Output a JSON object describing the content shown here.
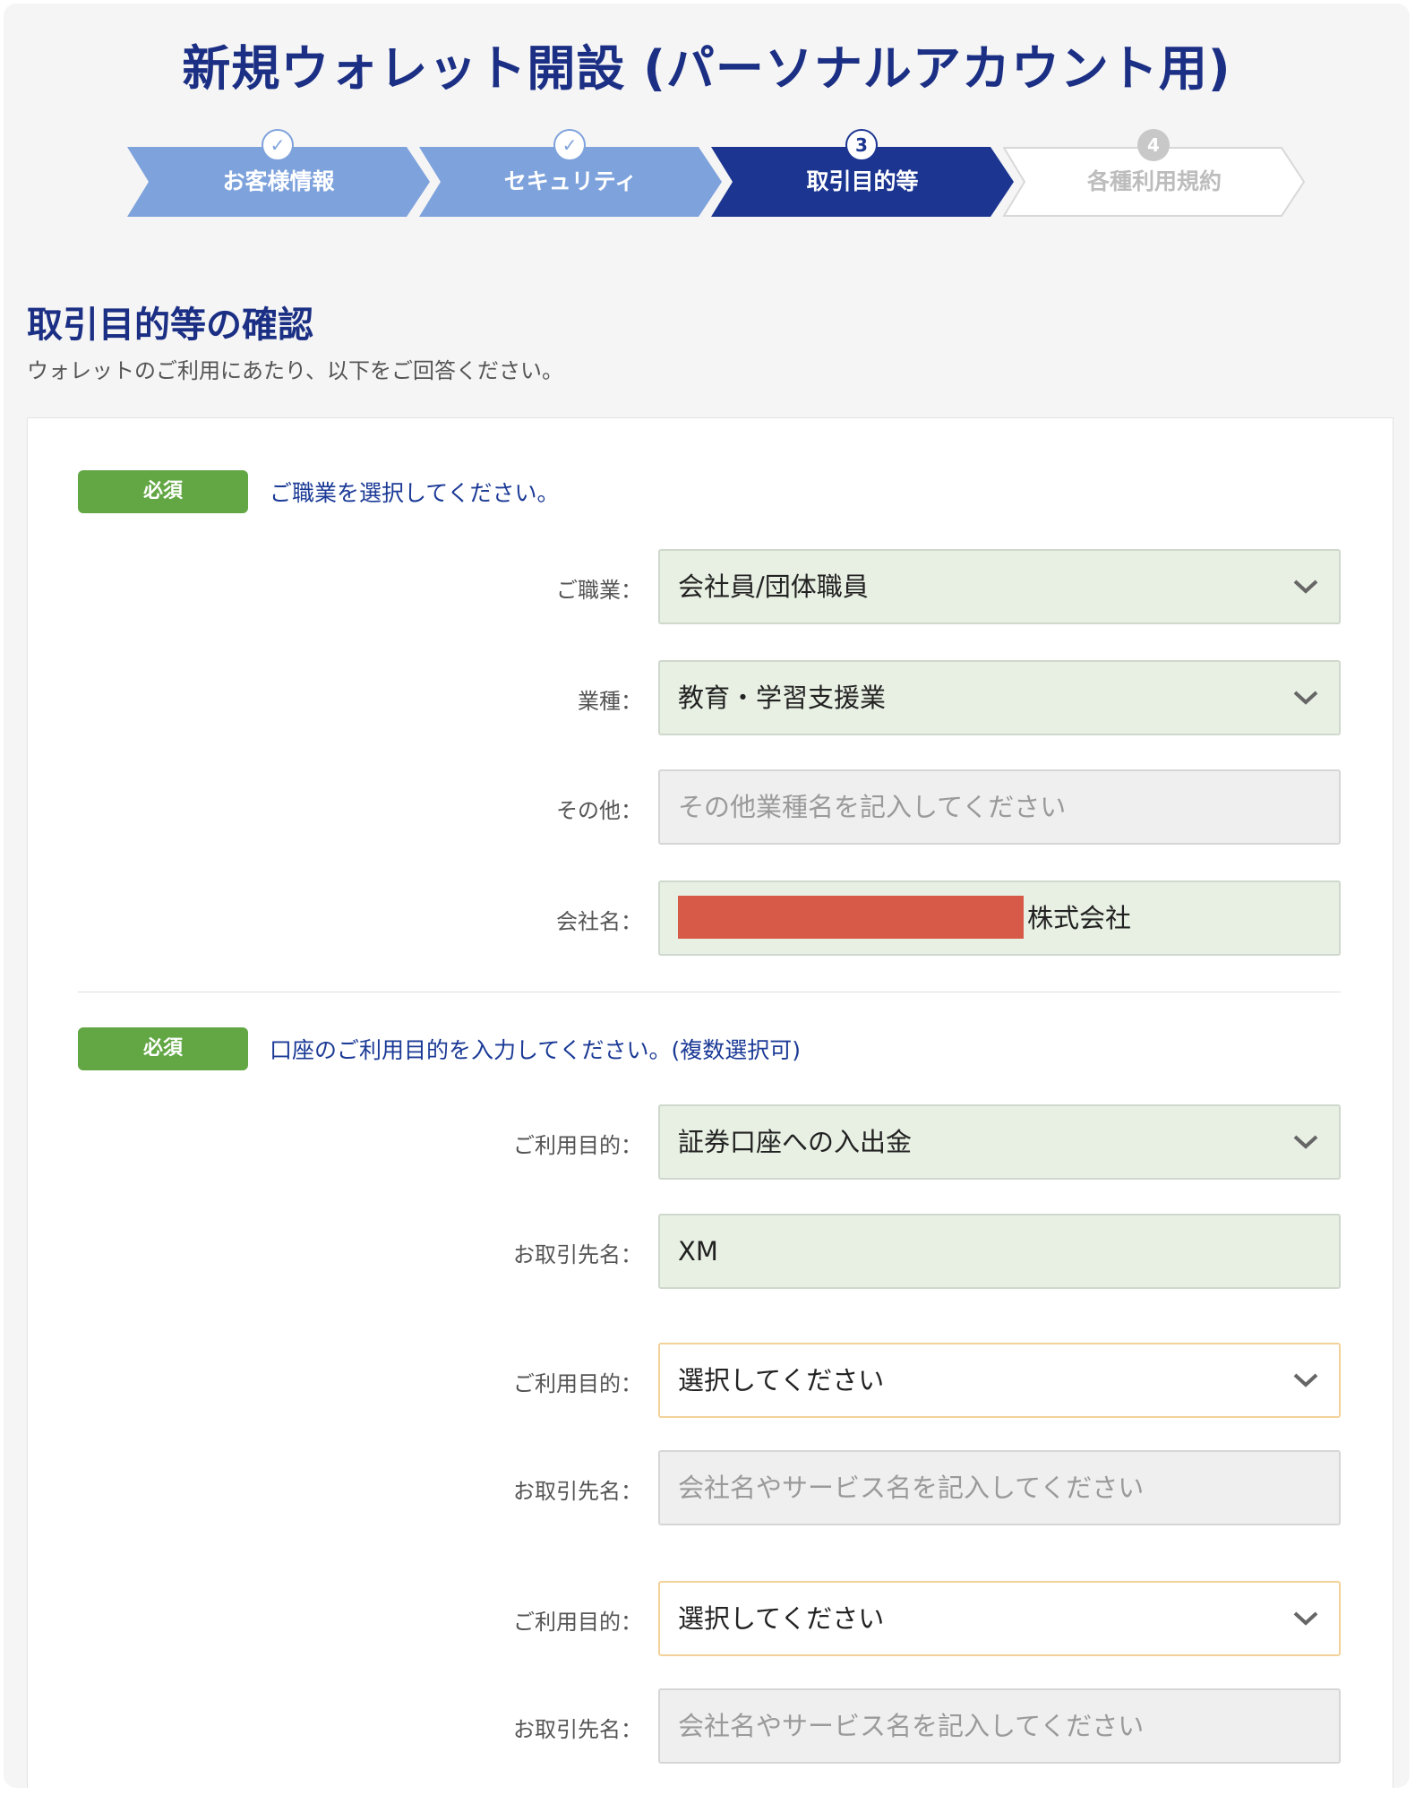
{
  "page_title": "新規ウォレット開設 (パーソナルアカウント用)",
  "steps": [
    {
      "label": "お客様情報",
      "marker": "✓",
      "state": "done"
    },
    {
      "label": "セキュリティ",
      "marker": "✓",
      "state": "done"
    },
    {
      "label": "取引目的等",
      "marker": "3",
      "state": "active"
    },
    {
      "label": "各種利用規約",
      "marker": "4",
      "state": "pending"
    }
  ],
  "section": {
    "title": "取引目的等の確認",
    "description": "ウォレットのご利用にあたり、以下をご回答ください。"
  },
  "required_badge": "必須",
  "occupation_block": {
    "question": "ご職業を選択してください。",
    "occupation_label": "ご職業：",
    "occupation_value": "会社員/団体職員",
    "industry_label": "業種：",
    "industry_value": "教育・学習支援業",
    "other_label": "その他：",
    "other_placeholder": "その他業種名を記入してください",
    "company_label": "会社名：",
    "company_value_suffix": "株式会社"
  },
  "purpose_block": {
    "question": "口座のご利用目的を入力してください。(複数選択可)",
    "purpose_label": "ご利用目的：",
    "partner_label": "お取引先名：",
    "entries": [
      {
        "purpose": "証券口座への入出金",
        "partner": "XM"
      },
      {
        "purpose": "選択してください",
        "partner_placeholder": "会社名やサービス名を記入してください"
      },
      {
        "purpose": "選択してください",
        "partner_placeholder": "会社名やサービス名を記入してください"
      }
    ]
  },
  "colors": {
    "brand_navy": "#1b2f84",
    "step_done": "#7ea2dc",
    "step_active": "#1b3591",
    "required_green": "#62a744",
    "filled_bg": "#e8f0e3",
    "redaction": "#d75947"
  },
  "icons": {
    "select_arrow": "chevron-down-icon",
    "done_step": "check-icon"
  }
}
